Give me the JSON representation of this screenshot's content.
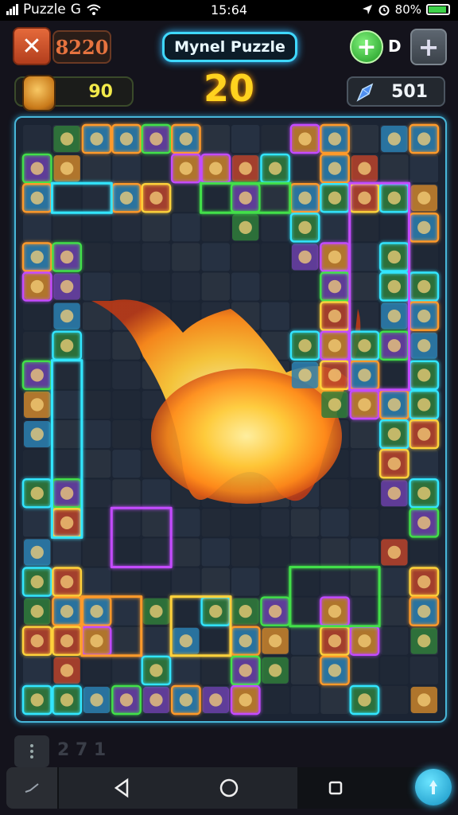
{
  "status": {
    "app_name": "Puzzle",
    "carrier": "G",
    "time": "15:64",
    "battery": "80%"
  },
  "header": {
    "close_icon": "✕",
    "score": "8220",
    "title": "Mynel Puzzle",
    "plus": "+",
    "d_label": "D",
    "grey_plus": "+"
  },
  "stats": {
    "coins": "90",
    "level": "20",
    "gems": "501"
  },
  "board": {
    "columns": 14,
    "rows": 20,
    "glow_colors": [
      "#32e6ff",
      "#c44cff",
      "#42e04a",
      "#ff9a2a",
      "#ffd23a"
    ],
    "accent": "#ffb01e"
  },
  "footer": {
    "page_indicator": "2 7 1"
  },
  "icons": {
    "wifi": "wifi-icon",
    "location": "location-icon",
    "alarm": "alarm-icon",
    "coin": "coin-icon",
    "gem": "gem-icon",
    "back": "back-triangle-icon",
    "home": "home-circle-icon",
    "recents": "recents-square-icon",
    "boost": "boost-icon"
  }
}
